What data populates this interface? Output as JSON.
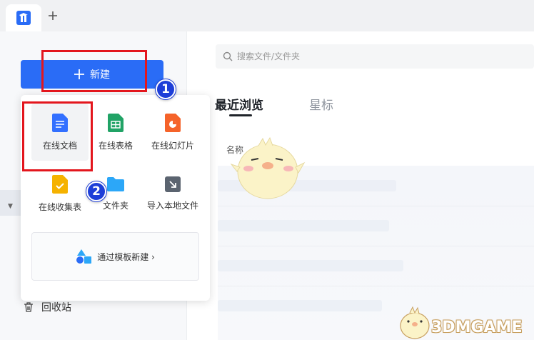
{
  "tabs": {
    "add_label": "+"
  },
  "sidebar": {
    "new_button_label": "新建",
    "recycle_label": "回收站"
  },
  "menu": {
    "items": [
      {
        "label": "在线文档",
        "icon": "doc-icon",
        "color": "#3370ff"
      },
      {
        "label": "在线表格",
        "icon": "sheet-icon",
        "color": "#21a366"
      },
      {
        "label": "在线幻灯片",
        "icon": "slides-icon",
        "color": "#f5632a"
      },
      {
        "label": "在线收集表",
        "icon": "form-icon",
        "color": "#f5b200"
      },
      {
        "label": "文件夹",
        "icon": "folder-icon",
        "color": "#2ca7f8"
      },
      {
        "label": "导入本地文件",
        "icon": "import-icon",
        "color": "#5b6470"
      }
    ],
    "template_label": "通过模板新建 ›"
  },
  "annotations": {
    "num1": "1",
    "num2": "2"
  },
  "main": {
    "search_placeholder": "搜索文件/文件夹",
    "tabs": [
      {
        "label": "最近浏览"
      },
      {
        "label": "星标"
      }
    ],
    "column_name": "名称"
  },
  "watermark": "3DMGAME",
  "colors": {
    "accent": "#2a6cf6",
    "annotation_red": "#e3161d",
    "annotation_blue": "#1e3fd8"
  }
}
